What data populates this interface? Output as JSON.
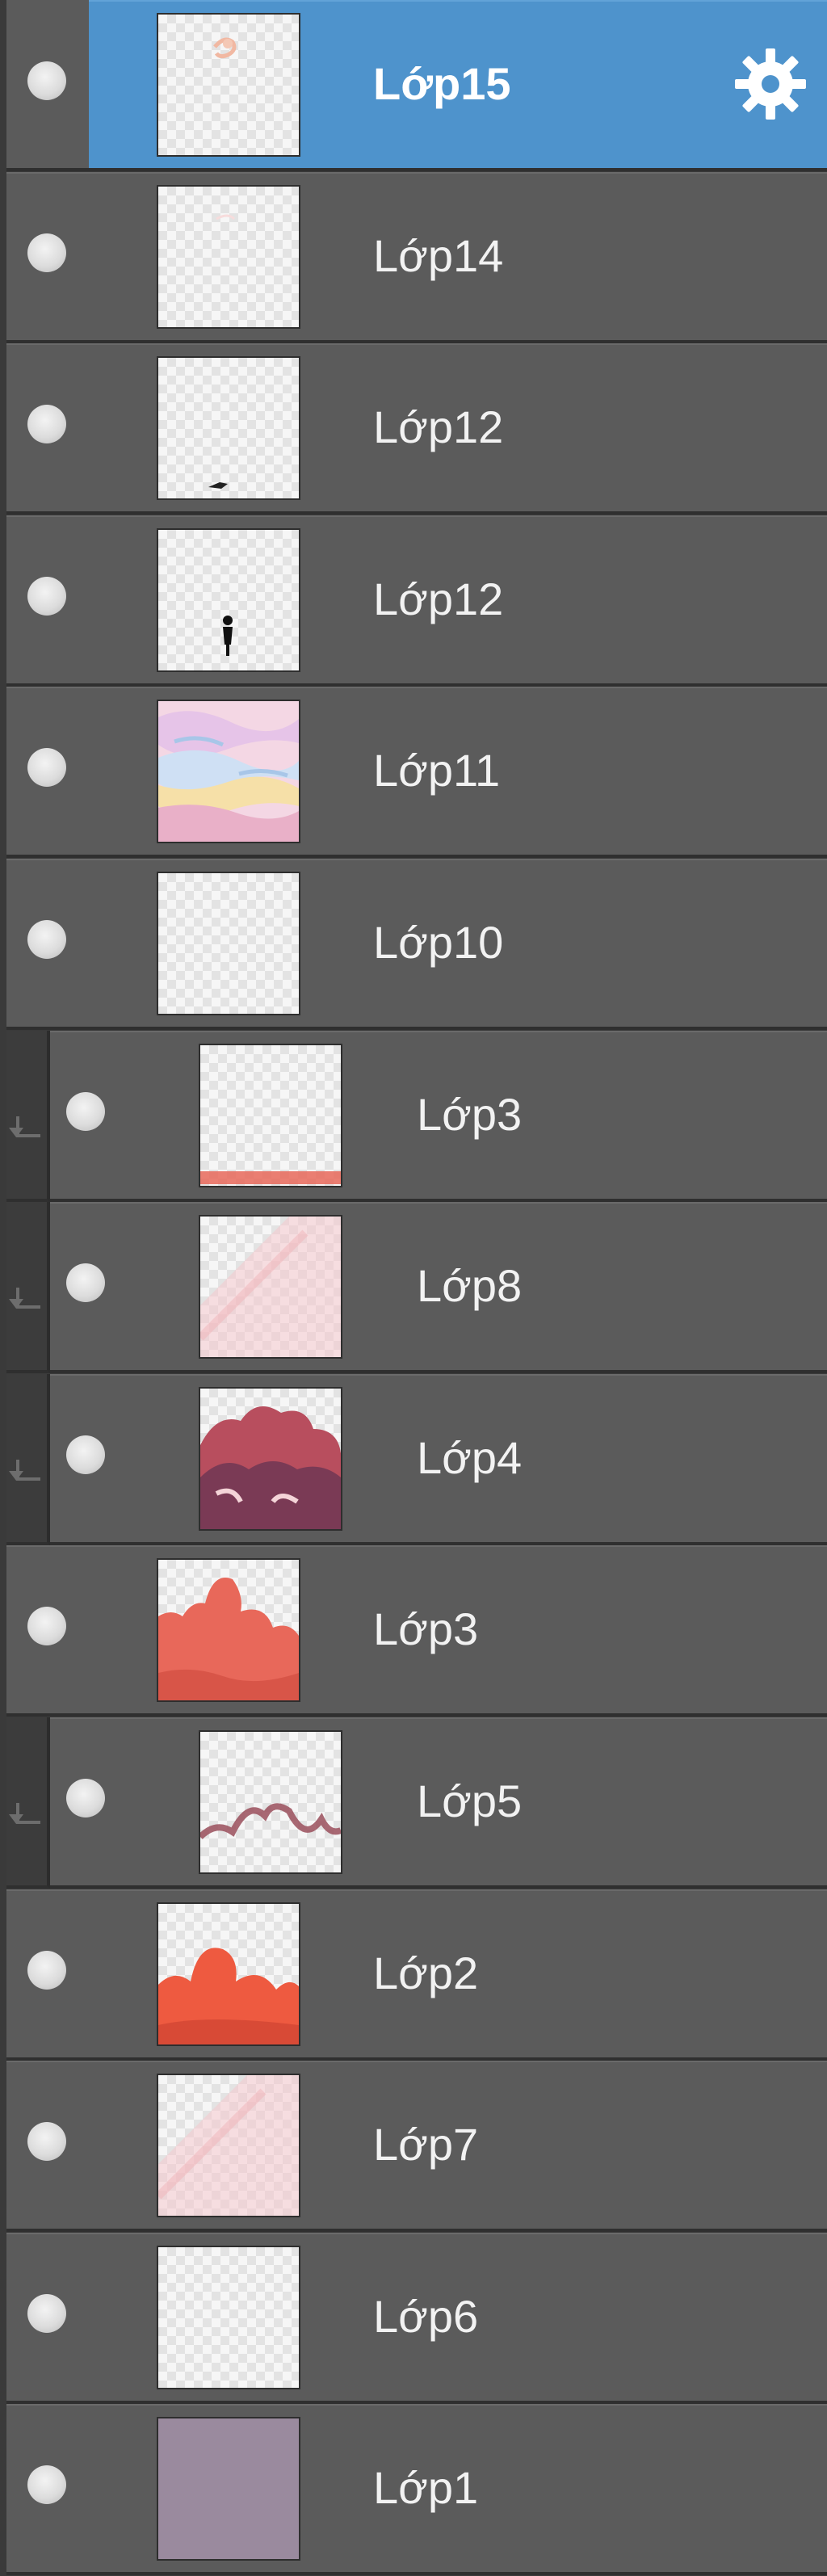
{
  "layers": [
    {
      "name": "Lớp15",
      "selected": true,
      "clipped": false,
      "thumb": "sketch"
    },
    {
      "name": "Lớp14",
      "selected": false,
      "clipped": false,
      "thumb": "faint"
    },
    {
      "name": "Lớp12",
      "selected": false,
      "clipped": false,
      "thumb": "bird"
    },
    {
      "name": "Lớp12",
      "selected": false,
      "clipped": false,
      "thumb": "figure"
    },
    {
      "name": "Lớp11",
      "selected": false,
      "clipped": false,
      "thumb": "clouds"
    },
    {
      "name": "Lớp10",
      "selected": false,
      "clipped": false,
      "thumb": "empty"
    },
    {
      "name": "Lớp3",
      "selected": false,
      "clipped": true,
      "thumb": "strip"
    },
    {
      "name": "Lớp8",
      "selected": false,
      "clipped": true,
      "thumb": "pink-haze"
    },
    {
      "name": "Lớp4",
      "selected": false,
      "clipped": true,
      "thumb": "mountains-dark"
    },
    {
      "name": "Lớp3",
      "selected": false,
      "clipped": false,
      "thumb": "mountains-coral"
    },
    {
      "name": "Lớp5",
      "selected": false,
      "clipped": true,
      "thumb": "ridge-line"
    },
    {
      "name": "Lớp2",
      "selected": false,
      "clipped": false,
      "thumb": "mountains-red"
    },
    {
      "name": "Lớp7",
      "selected": false,
      "clipped": false,
      "thumb": "pink-haze"
    },
    {
      "name": "Lớp6",
      "selected": false,
      "clipped": false,
      "thumb": "empty"
    },
    {
      "name": "Lớp1",
      "selected": false,
      "clipped": false,
      "thumb": "solid"
    }
  ],
  "colors": {
    "selected_bg": "#4e93cc",
    "row_bg": "#5b5b5b",
    "solid_fill": "#9a8a9e",
    "coral": "#e8685a",
    "red": "#ee5a40"
  },
  "icons": {
    "visibility": "eye-icon",
    "settings": "gear-icon",
    "clipping": "clip-arrow-icon"
  }
}
